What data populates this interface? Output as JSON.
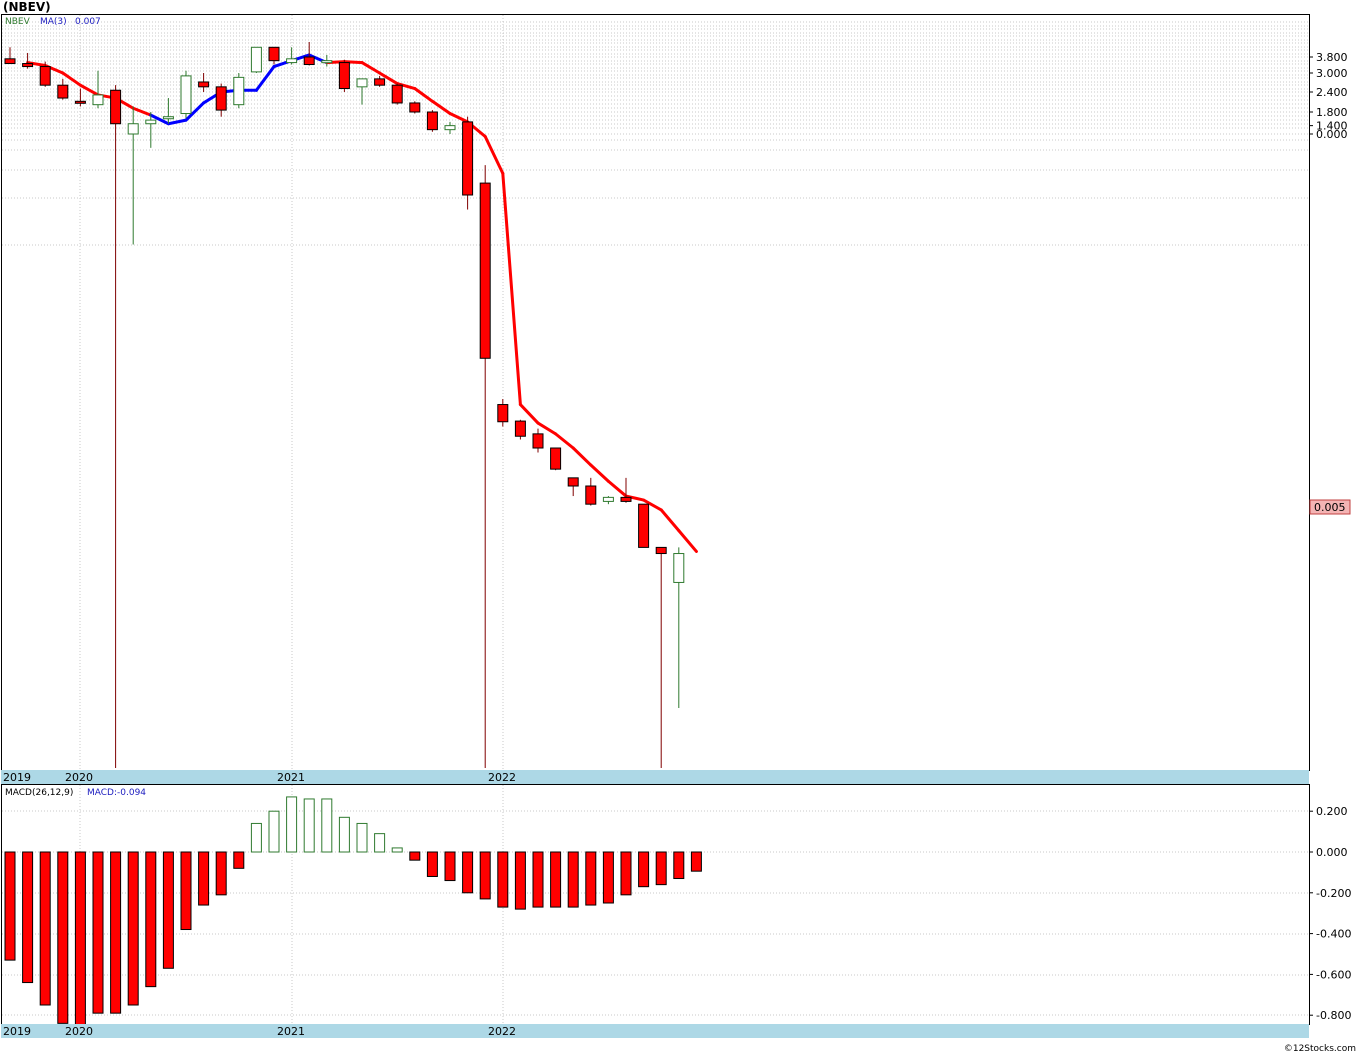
{
  "header": {
    "title": "(NBEV)"
  },
  "legend": {
    "symbol": "NBEV",
    "ma_label": "MA(3)",
    "ma_value": "0.007"
  },
  "macd_legend": {
    "label": "MACD(26,12,9)",
    "value": "MACD:-0.094"
  },
  "last_price_label": "0.005",
  "footer": "©12Stocks.com",
  "colors": {
    "up": "#2f7a2f",
    "down": "#ff0000",
    "ma_up": "#0000ff",
    "ma_down": "#ff0000",
    "axis_band": "#add8e6",
    "grid": "#b0b0b0"
  },
  "chart_data": [
    {
      "type": "candlestick",
      "title": "",
      "interval": "monthly",
      "scale": "nonlinear (as printed)",
      "y_tick_labels": [
        "3.800",
        "3.000",
        "2.400",
        "1.800",
        "1.400",
        "0.000"
      ],
      "x_year_labels": [
        "2019",
        "2020",
        "2021",
        "2022"
      ],
      "grid": true,
      "last_value": 0.005,
      "ma": {
        "name": "MA(3)",
        "value": 0.007
      },
      "candles_approx": [
        {
          "o": 3.7,
          "h": 4.3,
          "l": 3.45,
          "c": 3.45
        },
        {
          "o": 3.45,
          "h": 4.0,
          "l": 3.2,
          "c": 3.3
        },
        {
          "o": 3.3,
          "h": 3.55,
          "l": 2.55,
          "c": 2.6
        },
        {
          "o": 2.6,
          "h": 2.8,
          "l": 2.15,
          "c": 2.2
        },
        {
          "o": 2.1,
          "h": 2.5,
          "l": 1.95,
          "c": 2.05
        },
        {
          "o": 2.0,
          "h": 3.1,
          "l": 1.9,
          "c": 2.3
        },
        {
          "o": 2.45,
          "h": 2.6,
          "l": 0.0,
          "c": 1.45
        },
        {
          "o": 1.2,
          "h": 1.95,
          "l": 0.15,
          "c": 1.45
        },
        {
          "o": 1.45,
          "h": 1.8,
          "l": 0.95,
          "c": 1.55
        },
        {
          "o": 1.6,
          "h": 2.2,
          "l": 1.45,
          "c": 1.65
        },
        {
          "o": 1.75,
          "h": 3.1,
          "l": 1.6,
          "c": 2.9
        },
        {
          "o": 2.7,
          "h": 3.0,
          "l": 2.4,
          "c": 2.55
        },
        {
          "o": 2.55,
          "h": 2.65,
          "l": 1.65,
          "c": 1.85
        },
        {
          "o": 2.0,
          "h": 3.0,
          "l": 1.9,
          "c": 2.85
        },
        {
          "o": 3.05,
          "h": 4.3,
          "l": 3.0,
          "c": 4.3
        },
        {
          "o": 4.3,
          "h": 4.3,
          "l": 3.4,
          "c": 3.6
        },
        {
          "o": 3.5,
          "h": 4.3,
          "l": 3.4,
          "c": 3.7
        },
        {
          "o": 3.8,
          "h": 4.6,
          "l": 3.35,
          "c": 3.4
        },
        {
          "o": 3.5,
          "h": 3.9,
          "l": 3.3,
          "c": 3.6
        },
        {
          "o": 3.5,
          "h": 3.65,
          "l": 2.4,
          "c": 2.5
        },
        {
          "o": 2.55,
          "h": 2.8,
          "l": 2.0,
          "c": 2.8
        },
        {
          "o": 2.8,
          "h": 2.9,
          "l": 2.55,
          "c": 2.6
        },
        {
          "o": 2.6,
          "h": 2.65,
          "l": 2.0,
          "c": 2.05
        },
        {
          "o": 2.05,
          "h": 2.1,
          "l": 1.75,
          "c": 1.8
        },
        {
          "o": 1.8,
          "h": 1.85,
          "l": 1.25,
          "c": 1.3
        },
        {
          "o": 1.3,
          "h": 1.5,
          "l": 1.2,
          "c": 1.4
        },
        {
          "o": 1.5,
          "h": 1.65,
          "l": 0.3,
          "c": 0.4
        },
        {
          "o": 0.5,
          "h": 0.7,
          "l": 0.0,
          "c": 0.03
        },
        {
          "o": 0.02,
          "h": 0.021,
          "l": 0.0165,
          "c": 0.0172
        },
        {
          "o": 0.0173,
          "h": 0.0175,
          "l": 0.0148,
          "c": 0.0152
        },
        {
          "o": 0.0155,
          "h": 0.0162,
          "l": 0.0133,
          "c": 0.0138
        },
        {
          "o": 0.0138,
          "h": 0.0138,
          "l": 0.0115,
          "c": 0.0116
        },
        {
          "o": 0.0108,
          "h": 0.0108,
          "l": 0.0093,
          "c": 0.0101
        },
        {
          "o": 0.0101,
          "h": 0.0108,
          "l": 0.0086,
          "c": 0.0087
        },
        {
          "o": 0.0089,
          "h": 0.0093,
          "l": 0.0087,
          "c": 0.0092
        },
        {
          "o": 0.0092,
          "h": 0.0108,
          "l": 0.0088,
          "c": 0.0089
        },
        {
          "o": 0.0087,
          "h": 0.0087,
          "l": 0.0061,
          "c": 0.0061
        },
        {
          "o": 0.0061,
          "h": 0.0061,
          "l": 0.0,
          "c": 0.0058
        },
        {
          "o": 0.0048,
          "h": 0.0061,
          "l": 0.0022,
          "c": 0.0058
        }
      ],
      "ma_values_approx": [
        3.5,
        3.35,
        3.0,
        2.6,
        2.3,
        2.2,
        1.9,
        1.7,
        1.45,
        1.55,
        2.05,
        2.4,
        2.45,
        2.45,
        3.3,
        3.6,
        3.9,
        3.5,
        3.55,
        3.5,
        3.0,
        2.65,
        2.5,
        2.1,
        1.75,
        1.5,
        1.15,
        0.6,
        0.02,
        0.017,
        0.0155,
        0.0138,
        0.012,
        0.0105,
        0.0093,
        0.009,
        0.0083,
        0.007,
        0.0059
      ],
      "ma_up_flags": [
        0,
        0,
        0,
        0,
        0,
        0,
        0,
        0,
        1,
        1,
        1,
        1,
        1,
        1,
        1,
        1,
        1,
        1,
        0,
        0,
        0,
        0,
        0,
        0,
        0,
        0,
        0,
        0,
        0,
        0,
        0,
        0,
        0,
        0,
        0,
        0,
        0,
        0,
        0
      ]
    },
    {
      "type": "bar",
      "title": "MACD(26,12,9)",
      "y_tick_labels": [
        "0.200",
        "0.000",
        "-0.200",
        "-0.400",
        "-0.600",
        "-0.800"
      ],
      "ylim": [
        -0.85,
        0.25
      ],
      "x_year_labels": [
        "2019",
        "2020",
        "2021",
        "2022"
      ],
      "values": [
        -0.53,
        -0.64,
        -0.75,
        -0.84,
        -0.86,
        -0.79,
        -0.79,
        -0.75,
        -0.66,
        -0.57,
        -0.38,
        -0.26,
        -0.21,
        -0.08,
        0.14,
        0.2,
        0.27,
        0.26,
        0.26,
        0.17,
        0.14,
        0.09,
        0.02,
        -0.04,
        -0.12,
        -0.14,
        -0.2,
        -0.23,
        -0.27,
        -0.28,
        -0.27,
        -0.27,
        -0.27,
        -0.26,
        -0.25,
        -0.21,
        -0.17,
        -0.16,
        -0.13,
        -0.094
      ]
    }
  ]
}
